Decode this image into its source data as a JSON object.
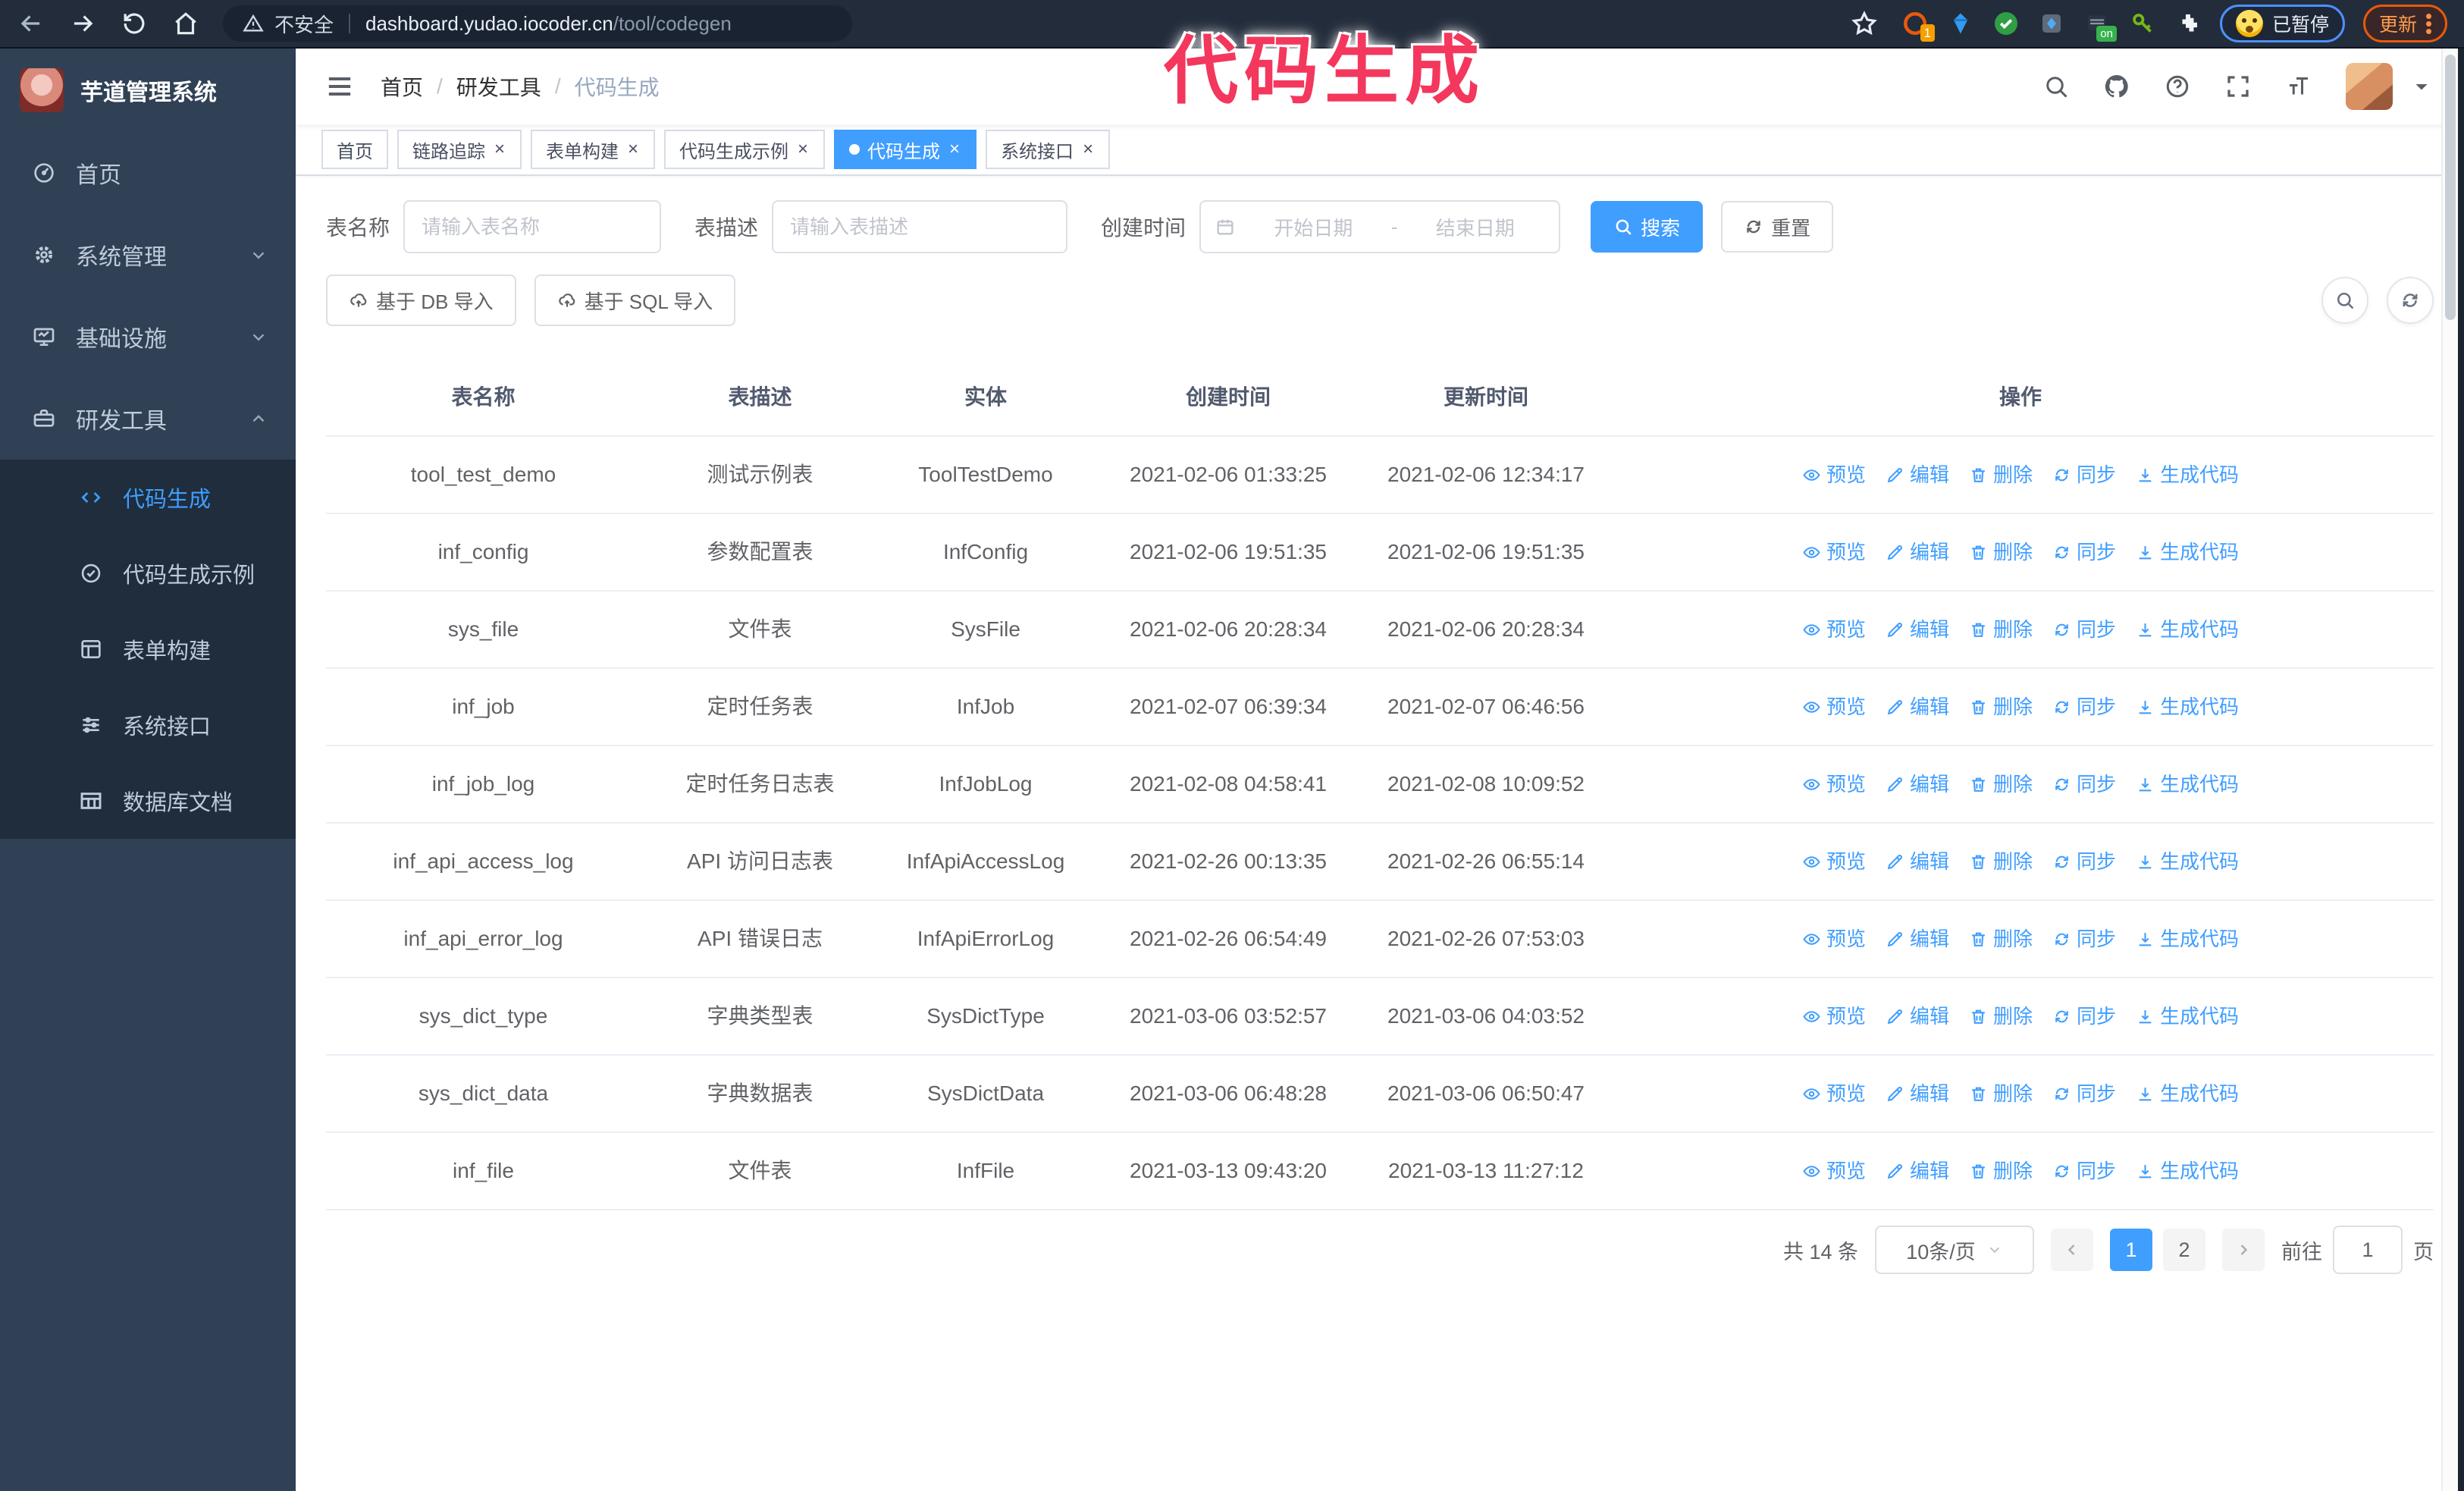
{
  "annotation": {
    "text": "代码生成",
    "color": "#f3375d"
  },
  "browser": {
    "security_label": "不安全",
    "url_host": "dashboard.yudao.iocoder.cn",
    "url_path": "/tool/codegen",
    "ext_badge_count": "1",
    "ext_badge_on": "on",
    "paused_badge": "已暂停",
    "update_badge": "更新"
  },
  "sidebar": {
    "title": "芋道管理系统",
    "items": [
      {
        "label": "首页",
        "icon": "dashboard-icon",
        "chevron": "",
        "active": false
      },
      {
        "label": "系统管理",
        "icon": "gear-icon",
        "chevron": "down",
        "active": false
      },
      {
        "label": "基础设施",
        "icon": "monitor-icon",
        "chevron": "down",
        "active": false
      },
      {
        "label": "研发工具",
        "icon": "toolbox-icon",
        "chevron": "up",
        "active": false
      }
    ],
    "submenu": [
      {
        "label": "代码生成",
        "icon": "code-icon",
        "active": true
      },
      {
        "label": "代码生成示例",
        "icon": "badge-check-icon",
        "active": false
      },
      {
        "label": "表单构建",
        "icon": "form-icon",
        "active": false
      },
      {
        "label": "系统接口",
        "icon": "api-icon",
        "active": false
      },
      {
        "label": "数据库文档",
        "icon": "database-doc-icon",
        "active": false
      }
    ]
  },
  "navbar": {
    "breadcrumb": [
      "首页",
      "研发工具",
      "代码生成"
    ],
    "icons": [
      "search-icon",
      "github-icon",
      "help-icon",
      "fullscreen-icon",
      "text-size-icon"
    ]
  },
  "tabs": [
    {
      "label": "首页",
      "closable": false,
      "active": false
    },
    {
      "label": "链路追踪",
      "closable": true,
      "active": false
    },
    {
      "label": "表单构建",
      "closable": true,
      "active": false
    },
    {
      "label": "代码生成示例",
      "closable": true,
      "active": false
    },
    {
      "label": "代码生成",
      "closable": true,
      "active": true
    },
    {
      "label": "系统接口",
      "closable": true,
      "active": false
    }
  ],
  "filters": {
    "table_name_label": "表名称",
    "table_name_placeholder": "请输入表名称",
    "table_desc_label": "表描述",
    "table_desc_placeholder": "请输入表描述",
    "create_time_label": "创建时间",
    "date_icon": "calendar-icon",
    "date_start_placeholder": "开始日期",
    "date_separator": "-",
    "date_end_placeholder": "结束日期",
    "search_label": "搜索",
    "search_icon": "search-icon",
    "reset_label": "重置",
    "reset_icon": "refresh-icon"
  },
  "toolbar": {
    "import_db_label": "基于 DB 导入",
    "import_sql_label": "基于 SQL 导入",
    "import_icon": "upload-cloud-icon",
    "right_buttons": [
      "search-icon",
      "refresh-icon"
    ]
  },
  "table": {
    "headers": [
      "表名称",
      "表描述",
      "实体",
      "创建时间",
      "更新时间",
      "操作"
    ],
    "actions": [
      {
        "label": "预览",
        "icon": "eye-icon"
      },
      {
        "label": "编辑",
        "icon": "edit-icon"
      },
      {
        "label": "删除",
        "icon": "trash-icon"
      },
      {
        "label": "同步",
        "icon": "sync-icon"
      },
      {
        "label": "生成代码",
        "icon": "download-icon"
      }
    ],
    "rows": [
      {
        "name": "tool_test_demo",
        "desc": "测试示例表",
        "entity": "ToolTestDemo",
        "created": "2021-02-06 01:33:25",
        "updated": "2021-02-06 12:34:17",
        "created_wrap": false,
        "updated_wrap": false
      },
      {
        "name": "inf_config",
        "desc": "参数配置表",
        "entity": "InfConfig",
        "created": "2021-02-06 19:51:35",
        "updated": "2021-02-06 19:51:35",
        "created_wrap": false,
        "updated_wrap": false
      },
      {
        "name": "sys_file",
        "desc": "文件表",
        "entity": "SysFile",
        "created": "2021-02-06 20:28:34",
        "updated": "2021-02-06 20:28:34",
        "created_wrap": true,
        "updated_wrap": true
      },
      {
        "name": "inf_job",
        "desc": "定时任务表",
        "entity": "InfJob",
        "created": "2021-02-07 06:39:34",
        "updated": "2021-02-07 06:46:56",
        "created_wrap": true,
        "updated_wrap": true
      },
      {
        "name": "inf_job_log",
        "desc": "定时任务日志表",
        "entity": "InfJobLog",
        "created": "2021-02-08 04:58:41",
        "updated": "2021-02-08 10:09:52",
        "created_wrap": true,
        "updated_wrap": true
      },
      {
        "name": "inf_api_access_log",
        "desc": "API 访问日志表",
        "entity": "InfApiAccessLog",
        "created": "2021-02-26 00:13:35",
        "updated": "2021-02-26 06:55:14",
        "created_wrap": false,
        "updated_wrap": true
      },
      {
        "name": "inf_api_error_log",
        "desc": "API 错误日志",
        "entity": "InfApiErrorLog",
        "created": "2021-02-26 06:54:49",
        "updated": "2021-02-26 07:53:03",
        "created_wrap": true,
        "updated_wrap": true
      },
      {
        "name": "sys_dict_type",
        "desc": "字典类型表",
        "entity": "SysDictType",
        "created": "2021-03-06 03:52:57",
        "updated": "2021-03-06 04:03:52",
        "created_wrap": true,
        "updated_wrap": true
      },
      {
        "name": "sys_dict_data",
        "desc": "字典数据表",
        "entity": "SysDictData",
        "created": "2021-03-06 06:48:28",
        "updated": "2021-03-06 06:50:47",
        "created_wrap": true,
        "updated_wrap": true
      },
      {
        "name": "inf_file",
        "desc": "文件表",
        "entity": "InfFile",
        "created": "2021-03-13 09:43:20",
        "updated": "2021-03-13 11:27:12",
        "created_wrap": true,
        "updated_wrap": false
      }
    ]
  },
  "pagination": {
    "total_label": "共 14 条",
    "page_size": "10条/页",
    "pages": [
      "1",
      "2"
    ],
    "active_page": "1",
    "goto_label": "前往",
    "goto_value": "1",
    "page_unit": "页"
  },
  "colors": {
    "primary": "#409EFF",
    "sidebar_bg": "#304156",
    "submenu_bg": "#1f2d3d",
    "annotation": "#f3375d",
    "tab_active": "#409EFF"
  }
}
